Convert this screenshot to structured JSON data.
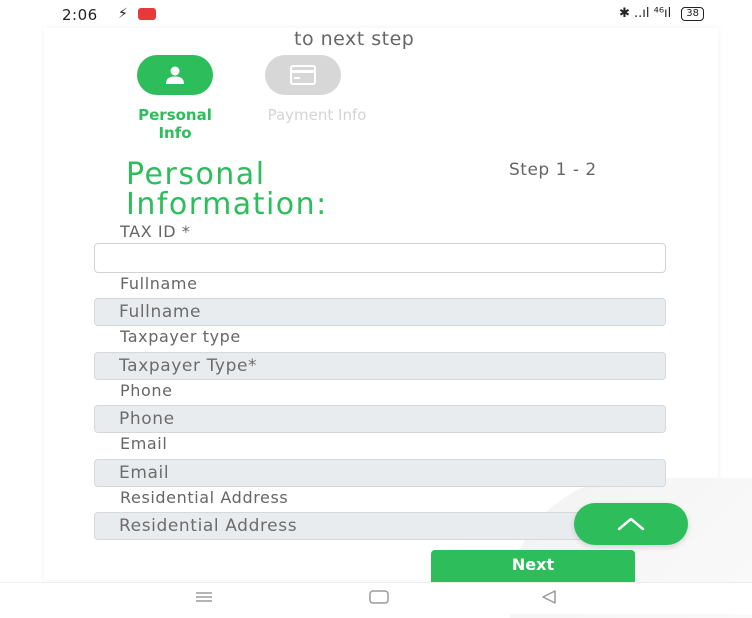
{
  "status_bar": {
    "time": "2:06",
    "left_icons": [
      "bluetooth-off-icon",
      "notification-badge-icon"
    ],
    "right_text": "✱ ..ıl ⁴⁶ıl",
    "battery": "38"
  },
  "form": {
    "hint_text": "to next step",
    "steps": [
      {
        "label": "Personal Info",
        "icon": "user-icon",
        "active": true
      },
      {
        "label": "Payment Info",
        "icon": "credit-card-icon",
        "active": false
      }
    ],
    "title": "Personal Information:",
    "step_indicator": "Step 1 - 2",
    "fields": [
      {
        "label": "TAX ID *",
        "placeholder": "",
        "value": ""
      },
      {
        "label": "Fullname",
        "placeholder": "Fullname",
        "value": ""
      },
      {
        "label": "Taxpayer type",
        "placeholder": "Taxpayer Type*",
        "value": ""
      },
      {
        "label": "Phone",
        "placeholder": "Phone",
        "value": ""
      },
      {
        "label": "Email",
        "placeholder": "Email",
        "value": ""
      },
      {
        "label": "Residential Address",
        "placeholder": "Residential Address",
        "value": ""
      }
    ],
    "next_label": "Next"
  },
  "nav_bar": {
    "buttons": [
      "menu-icon",
      "home-icon",
      "back-icon"
    ]
  },
  "colors": {
    "accent": "#2dbd5a",
    "inactive": "#d7d7d7",
    "readonly_bg": "#e9ecef"
  }
}
